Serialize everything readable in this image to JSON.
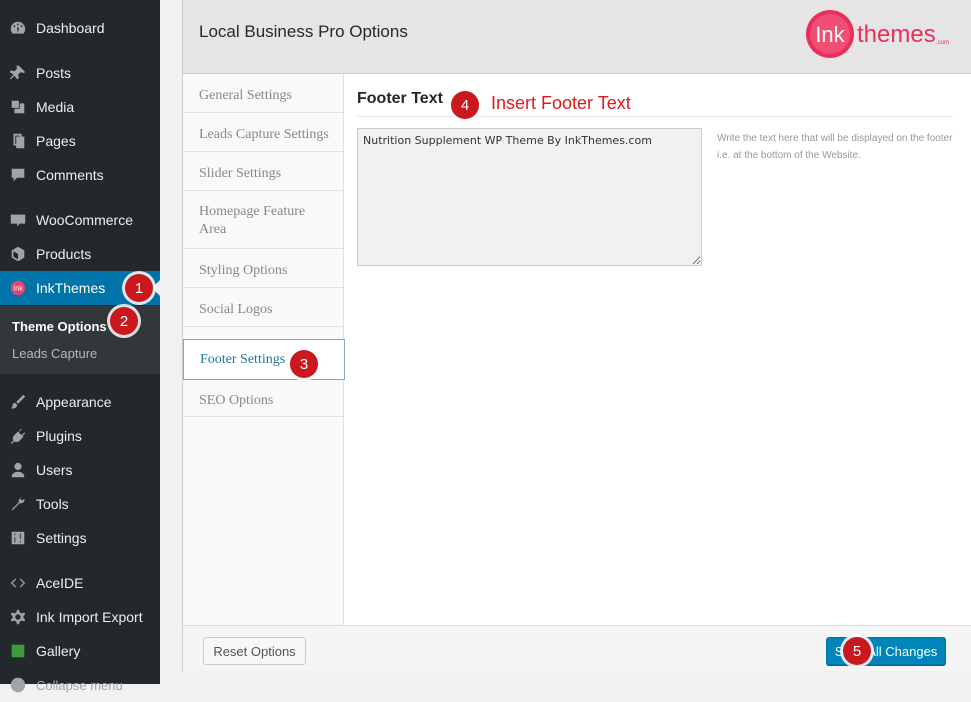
{
  "sidebar": {
    "items": [
      {
        "label": "Dashboard",
        "icon": "dashboard-icon"
      },
      {
        "label": "Posts",
        "icon": "pin-icon"
      },
      {
        "label": "Media",
        "icon": "media-icon"
      },
      {
        "label": "Pages",
        "icon": "pages-icon"
      },
      {
        "label": "Comments",
        "icon": "comment-icon"
      },
      {
        "label": "WooCommerce",
        "icon": "woocommerce-icon"
      },
      {
        "label": "Products",
        "icon": "box-icon"
      },
      {
        "label": "InkThemes",
        "icon": "inkthemes-icon"
      },
      {
        "label": "Appearance",
        "icon": "brush-icon"
      },
      {
        "label": "Plugins",
        "icon": "plug-icon"
      },
      {
        "label": "Users",
        "icon": "user-icon"
      },
      {
        "label": "Tools",
        "icon": "wrench-icon"
      },
      {
        "label": "Settings",
        "icon": "sliders-icon"
      },
      {
        "label": "AceIDE",
        "icon": "code-icon"
      },
      {
        "label": "Ink Import Export",
        "icon": "gear-icon"
      },
      {
        "label": "Gallery",
        "icon": "gallery-icon"
      },
      {
        "label": "Collapse menu",
        "icon": "collapse-icon"
      }
    ],
    "submenu": [
      "Theme Options",
      "Leads Capture"
    ]
  },
  "panel": {
    "title": "Local Business Pro Options",
    "logo_text": "Inkthemes.com"
  },
  "nav": [
    "General Settings",
    "Leads Capture Settings",
    "Slider Settings",
    "Homepage Feature Area",
    "Styling Options",
    "Social Logos",
    "Footer Settings",
    "SEO Options"
  ],
  "content": {
    "section_title": "Footer Text",
    "annotation": "Insert Footer Text",
    "textarea_value": "Nutrition Supplement WP Theme By InkThemes.com",
    "help_text": "Write the text here that will be displayed on the footer i.e. at the bottom of the Website."
  },
  "buttons": {
    "reset": "Reset Options",
    "save": "Save All Changes"
  },
  "badges": [
    "1",
    "2",
    "3",
    "4",
    "5"
  ],
  "colors": {
    "sidebar_bg": "#23282d",
    "active_bg": "#0073aa",
    "badge_red": "#c9181e",
    "annotation_red": "#e01a1a",
    "save_blue": "#0085ba"
  }
}
